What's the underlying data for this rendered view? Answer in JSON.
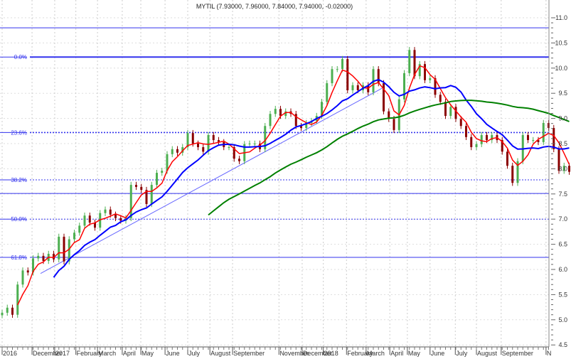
{
  "chart_data": {
    "type": "candlestick",
    "title": "MYTIL (7.93000, 7.96000, 7.84000, 7.94000, -0.02000)",
    "ylim": [
      4.5,
      11.0
    ],
    "yticks": [
      "4.5",
      "5.0",
      "5.5",
      "6.0",
      "6.5",
      "7.0",
      "7.5",
      "8.0",
      "8.5",
      "9.0",
      "9.5",
      "10.0",
      "10.5",
      "11.0"
    ],
    "grid": true,
    "colors": {
      "up": "#4caf50",
      "down": "#8b0000",
      "ma_short": "#ff0000",
      "ma_mid": "#0000ff",
      "ma_long": "#008000",
      "fib": "#3333ee",
      "trend": "#6666ff"
    },
    "ma_periods": {
      "short": 4,
      "mid": 11,
      "long": 41
    },
    "xticks": [
      {
        "label": "2016",
        "bar": 0
      },
      {
        "label": "December",
        "bar": 5.8
      },
      {
        "label": "2017",
        "bar": 10.2
      },
      {
        "label": "February",
        "bar": 14.3
      },
      {
        "label": "March",
        "bar": 18.5
      },
      {
        "label": "April",
        "bar": 23.3
      },
      {
        "label": "May",
        "bar": 26.9
      },
      {
        "label": "June",
        "bar": 31.6
      },
      {
        "label": "July",
        "bar": 36
      },
      {
        "label": "August",
        "bar": 40.3
      },
      {
        "label": "September",
        "bar": 44.7
      },
      {
        "label": "November",
        "bar": 53.7
      },
      {
        "label": "December",
        "bar": 58.2
      },
      {
        "label": "2018",
        "bar": 62.3
      },
      {
        "label": "February",
        "bar": 66.8
      },
      {
        "label": "March",
        "bar": 70.6
      },
      {
        "label": "April",
        "bar": 75.2
      },
      {
        "label": "May",
        "bar": 78.6
      },
      {
        "label": "June",
        "bar": 83
      },
      {
        "label": "July",
        "bar": 87.9
      },
      {
        "label": "August",
        "bar": 92
      },
      {
        "label": "September",
        "bar": 96.8
      },
      {
        "label": "N",
        "bar": 105.5
      }
    ],
    "closes": [
      5.14,
      5.24,
      5.1,
      5.7,
      5.98,
      5.94,
      6.22,
      6.27,
      6.17,
      6.31,
      6.2,
      6.65,
      6.16,
      6.6,
      6.73,
      6.87,
      7.07,
      6.93,
      6.83,
      7.12,
      7.19,
      7.09,
      7.02,
      6.97,
      7.02,
      7.68,
      7.64,
      7.58,
      7.3,
      7.68,
      7.92,
      7.96,
      8.29,
      8.39,
      8.32,
      8.43,
      8.71,
      8.5,
      8.43,
      8.34,
      8.67,
      8.57,
      8.53,
      8.43,
      8.43,
      8.2,
      8.15,
      8.49,
      8.5,
      8.5,
      8.39,
      8.85,
      9.09,
      9.19,
      9.05,
      9.14,
      9.09,
      8.85,
      8.81,
      8.91,
      8.95,
      9.05,
      9.33,
      9.7,
      9.98,
      9.98,
      10.18,
      9.56,
      9.66,
      9.56,
      9.66,
      9.52,
      9.98,
      9.7,
      9.14,
      8.99,
      8.77,
      9.38,
      9.9,
      10.36,
      9.84,
      10.08,
      9.76,
      9.8,
      9.47,
      9.33,
      9.05,
      9.23,
      8.99,
      8.85,
      8.63,
      8.43,
      8.49,
      8.67,
      8.57,
      8.67,
      8.57,
      8.34,
      8.06,
      7.72,
      8.15,
      8.67,
      8.57,
      8.57,
      8.53,
      8.91,
      8.81,
      8.39,
      7.96,
      8.06,
      7.94
    ],
    "horizontal_lines": [
      {
        "value": 10.8,
        "label": "",
        "style": "solid"
      },
      {
        "value": 10.22,
        "label": "0.0%",
        "style": "thick"
      },
      {
        "value": 8.72,
        "label": "23.6%",
        "style": "dotted-thick"
      },
      {
        "value": 7.78,
        "label": "38.2%",
        "style": "dotted"
      },
      {
        "value": 7.51,
        "label": "",
        "style": "solid"
      },
      {
        "value": 7.0,
        "label": "50.0%",
        "style": "dotted"
      },
      {
        "value": 6.24,
        "label": "61.8%",
        "style": "solid"
      }
    ],
    "trendline": {
      "from": {
        "bar": 7.45,
        "value": 5.92
      },
      "to": {
        "bar": 73.7,
        "value": 9.6
      }
    }
  }
}
